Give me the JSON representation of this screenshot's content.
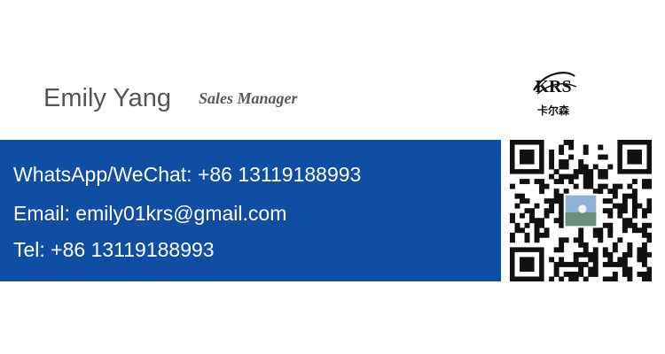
{
  "card": {
    "name": "Emily Yang",
    "title": "Sales Manager",
    "logo": {
      "mark_text": "KRS",
      "sub_text": "卡尔森",
      "color": "#111111"
    },
    "contact": {
      "whatsapp_line": "WhatsApp/WeChat: +86 13119188993",
      "email_line": "Email: emily01krs@gmail.com",
      "tel_line": "Tel: +86 13119188993"
    },
    "band_color": "#0f4ea3",
    "qr_icon": "qr-code-icon"
  }
}
